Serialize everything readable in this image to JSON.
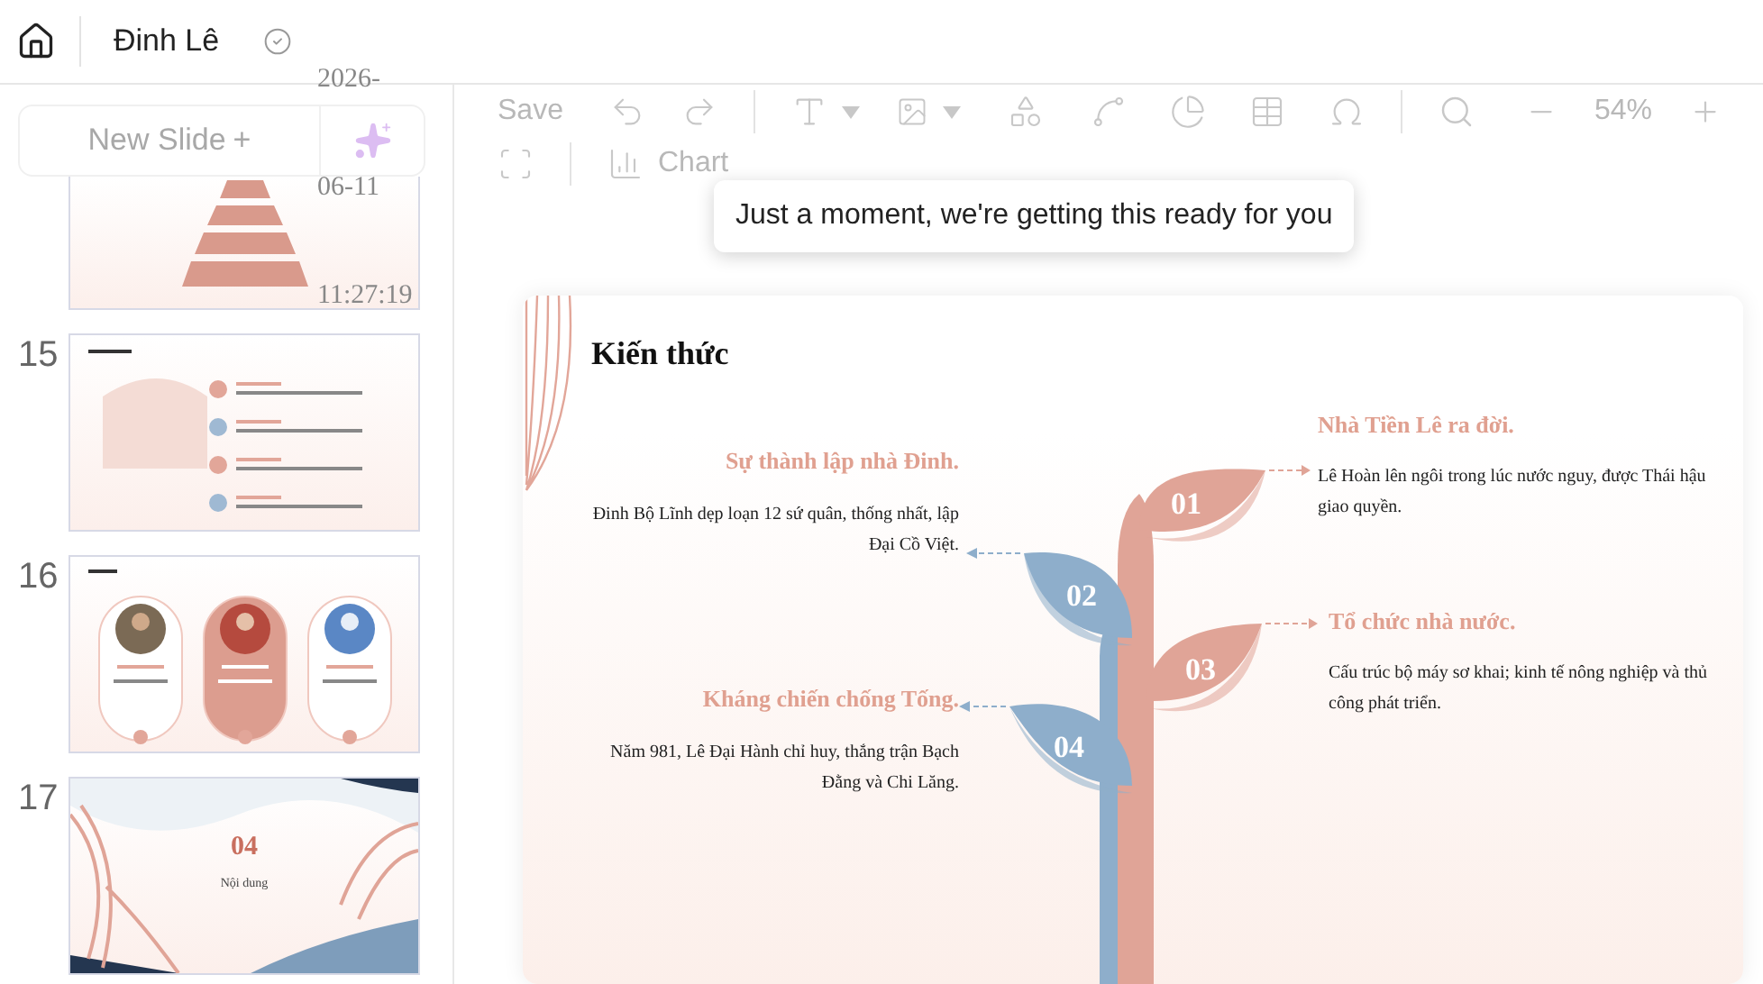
{
  "header": {
    "title": "Đinh Lê",
    "saved": true
  },
  "timestamp": [
    "2026-",
    "06-11",
    "11:27:19"
  ],
  "sidebar": {
    "new_slide": "New Slide",
    "new_slide_icon": "+",
    "disabled": true,
    "slides": [
      {
        "kind": "pyramid"
      },
      {
        "number": "15",
        "kind": "list"
      },
      {
        "number": "16",
        "kind": "cards"
      },
      {
        "number": "17",
        "kind": "section",
        "big": "04",
        "caption": "Nội dung"
      }
    ]
  },
  "toolbar": {
    "disabled": true,
    "save": "Save",
    "zoom": "54%",
    "chart": "Chart"
  },
  "tooltip": "Just a moment, we're getting this ready for you",
  "slide": {
    "title": "Kiến thức",
    "items": [
      {
        "number": "01",
        "color": "#e0a497",
        "heading": "Nhà Tiền Lê ra đời.",
        "body": "Lê Hoàn lên ngôi trong lúc nước nguy, được Thái hậu giao quyền."
      },
      {
        "number": "02",
        "color": "#8eaecb",
        "heading": "Sự thành lập nhà Đinh.",
        "body": "Đinh Bộ Lĩnh dẹp loạn 12 sứ quân, thống nhất, lập Đại Cồ Việt."
      },
      {
        "number": "03",
        "color": "#e0a497",
        "heading": "Tổ chức nhà nước.",
        "body": "Cấu trúc bộ máy sơ khai; kinh tế nông nghiệp và thủ công phát triển."
      },
      {
        "number": "04",
        "color": "#8eaecb",
        "heading": "Kháng chiến chống Tống.",
        "body": "Năm 981, Lê Đại Hành chỉ huy, thắng trận Bạch Đằng và Chi Lăng."
      }
    ]
  }
}
